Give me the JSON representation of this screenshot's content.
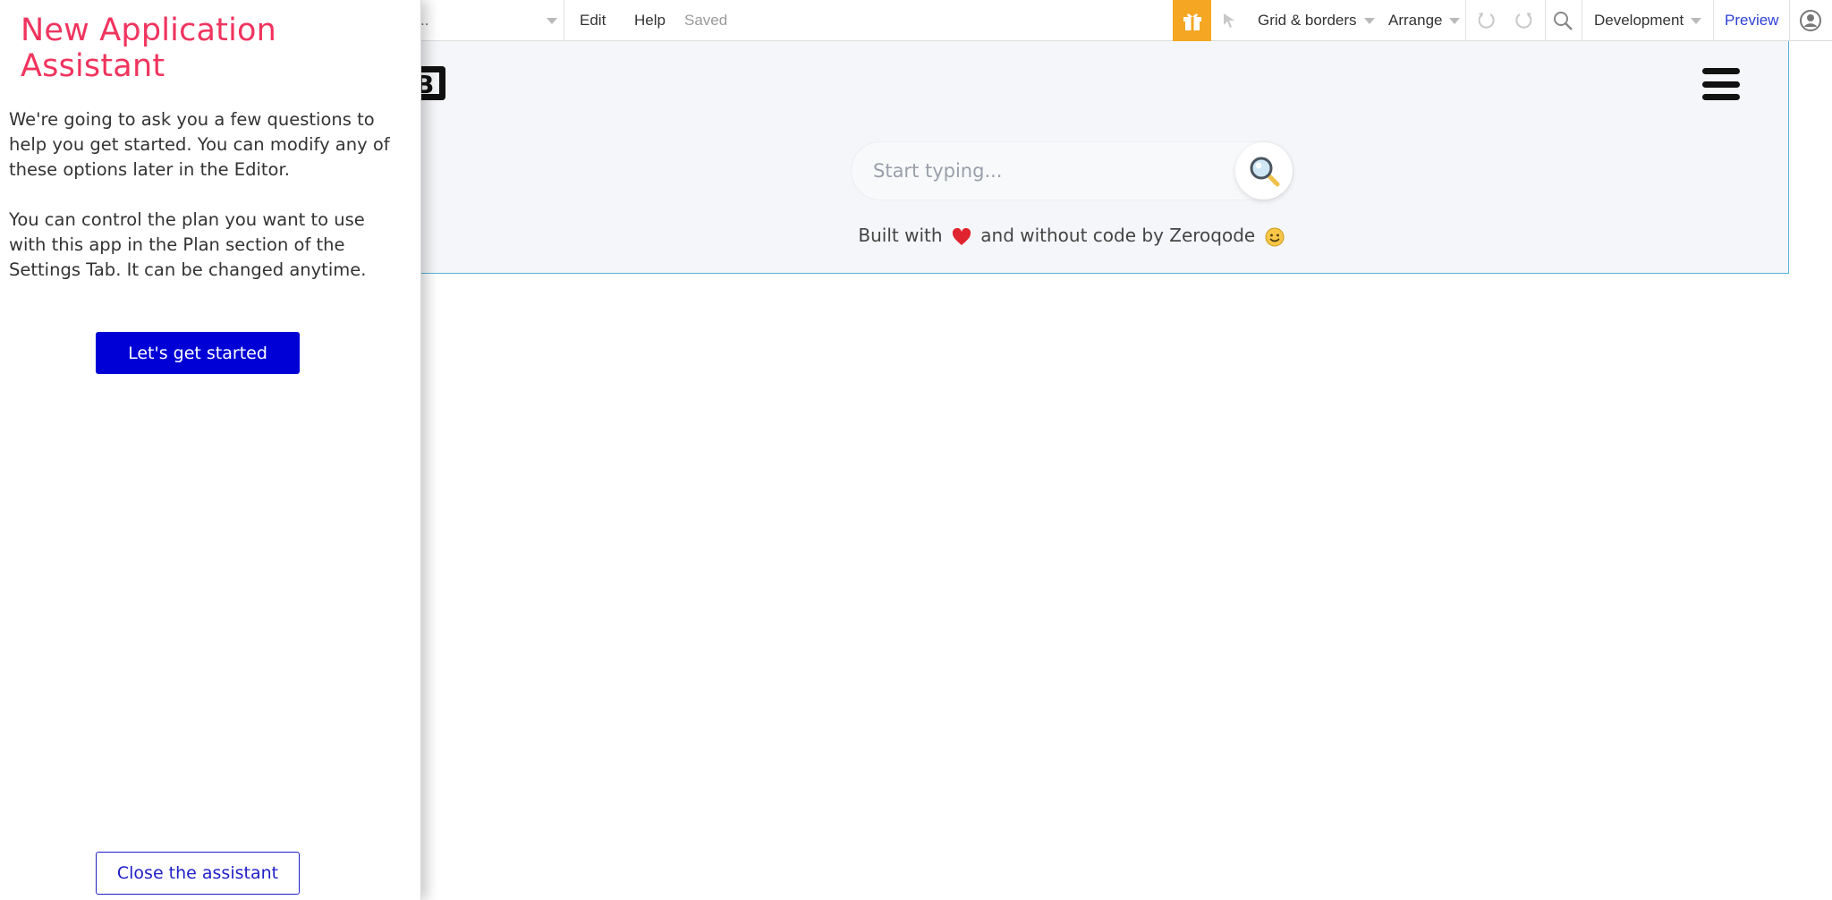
{
  "toolbar": {
    "page_select_value": "..",
    "edit_label": "Edit",
    "help_label": "Help",
    "saved_status": "Saved",
    "grid_borders_label": "Grid & borders",
    "arrange_label": "Arrange",
    "environment_label": "Development",
    "preview_label": "Preview",
    "gift_color": "#f5a623"
  },
  "canvas": {
    "search_placeholder": "Start typing...",
    "footer_prefix": "Built with",
    "footer_suffix": "and without code by Zeroqode"
  },
  "assistant": {
    "title": "New Application Assistant",
    "paragraph_1": "We're going to ask you a few questions to help you get started. You can modify any of these options later in the Editor.",
    "paragraph_2": "You can control the plan you want to use with this app in the Plan section of the Settings Tab. It can be changed anytime.",
    "get_started_label": "Let's get started",
    "close_label": "Close the assistant",
    "title_color": "#f0345e",
    "primary_color": "#0000d6"
  },
  "icons": [
    "gift-icon",
    "cursor-icon",
    "undo-icon",
    "redo-icon",
    "search-icon",
    "user-icon",
    "hamburger-icon",
    "magnifier-icon",
    "heart-icon",
    "smile-icon"
  ]
}
